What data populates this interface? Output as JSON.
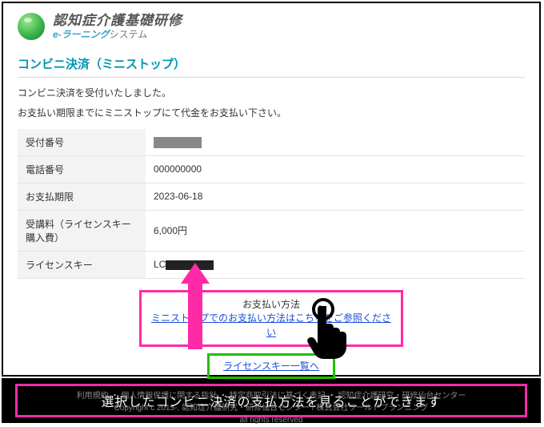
{
  "header": {
    "app_title": "認知症介護基礎研修",
    "sub_e": "e-ラーニング",
    "sub_rest": "システム"
  },
  "section_title": "コンビニ決済（ミニストップ）",
  "messages": {
    "received": "コンビニ決済を受付いたしました。",
    "instruction": "お支払い期限までにミニストップにて代金をお支払い下さい。"
  },
  "rows": {
    "receipt_label": "受付番号",
    "receipt_value": "",
    "phone_label": "電話番号",
    "phone_value": "000000000",
    "due_label": "お支払期限",
    "due_value": "2023-06-18",
    "fee_label": "受講料（ライセンスキー購入費）",
    "fee_value": "6,000円",
    "license_label": "ライセンスキー",
    "license_prefix": "LC"
  },
  "payment_box": {
    "title": "お支払い方法",
    "link": "ミニストップでのお支払い方法はこちらをご参照ください"
  },
  "license_list_link": "ライセンスキー一覧へ",
  "footer": {
    "l1a": "利用規約",
    "l1b": "個人情報保護に関する指針",
    "l1c": "特定商取引法に基づく表記",
    "l1d": "認知症介護研究・研修仙台センター",
    "l2": "Copyright c 2015-, 認知症介護研究・研修仙台センター / 株式会社ワールドプランニング",
    "l3": "all rights reserved"
  },
  "caption": "選択したコンビニ決済の支払方法を見ることができます"
}
